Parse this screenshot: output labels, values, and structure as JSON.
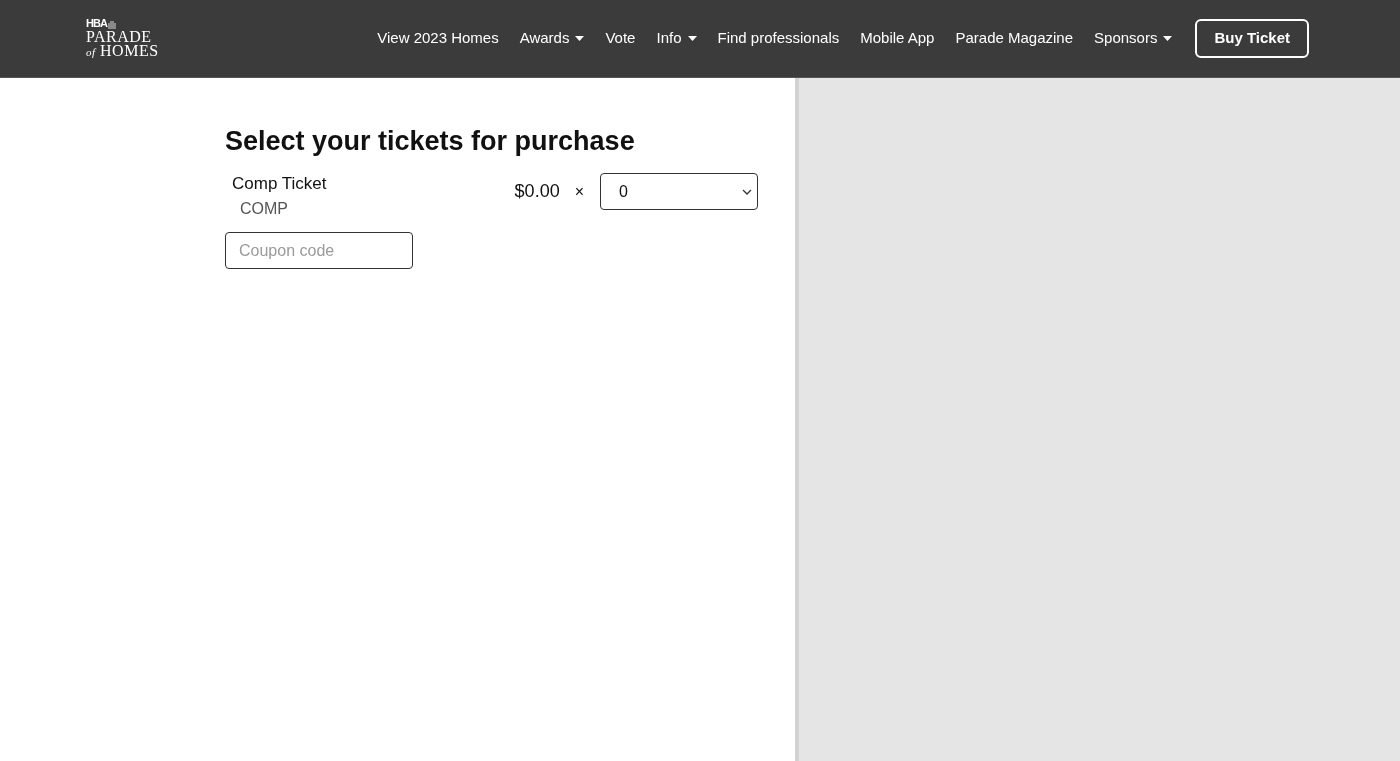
{
  "header": {
    "logo": {
      "mark": "HBA",
      "title": "PARADE",
      "subtitle": "*of* HOMES"
    },
    "nav": [
      {
        "label": "View 2023 Homes",
        "has_menu": false
      },
      {
        "label": "Awards",
        "has_menu": true
      },
      {
        "label": "Vote",
        "has_menu": false
      },
      {
        "label": "Info",
        "has_menu": true
      },
      {
        "label": "Find professionals",
        "has_menu": false
      },
      {
        "label": "Mobile App",
        "has_menu": false
      },
      {
        "label": "Parade Magazine",
        "has_menu": false
      },
      {
        "label": "Sponsors",
        "has_menu": true
      }
    ],
    "cta": {
      "label": "Buy Ticket"
    }
  },
  "purchase": {
    "title": "Select your tickets for purchase",
    "tickets": [
      {
        "name": "Comp Ticket",
        "code": "COMP",
        "price": "$0.00",
        "times": "×",
        "quantity": "0"
      }
    ],
    "coupon": {
      "placeholder": "Coupon code"
    }
  }
}
